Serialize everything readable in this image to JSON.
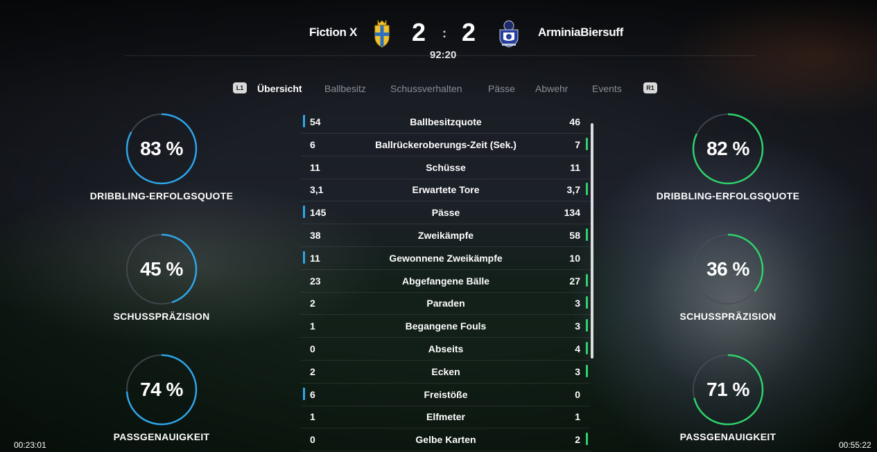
{
  "match": {
    "home_team": "Fiction X",
    "away_team": "ArminiaBiersuff",
    "home_score": "2",
    "away_score": "2",
    "separator": ":",
    "clock": "92:20"
  },
  "tabs": {
    "left_bumper": "L1",
    "right_bumper": "R1",
    "items": [
      {
        "label": "Übersicht",
        "active": true
      },
      {
        "label": "Ballbesitz",
        "active": false
      },
      {
        "label": "Schussverhalten",
        "active": false
      },
      {
        "label": "Pässe",
        "active": false
      },
      {
        "label": "Abwehr",
        "active": false
      },
      {
        "label": "Events",
        "active": false
      }
    ]
  },
  "home_rings": [
    {
      "value": "83 %",
      "fraction": 0.83,
      "label": "DRIBBLING-ERFOLGSQUOTE"
    },
    {
      "value": "45 %",
      "fraction": 0.45,
      "label": "SCHUSSPRÄZISION"
    },
    {
      "value": "74 %",
      "fraction": 0.74,
      "label": "PASSGENAUIGKEIT"
    }
  ],
  "away_rings": [
    {
      "value": "82 %",
      "fraction": 0.82,
      "label": "DRIBBLING-ERFOLGSQUOTE"
    },
    {
      "value": "36 %",
      "fraction": 0.36,
      "label": "SCHUSSPRÄZISION"
    },
    {
      "value": "71 %",
      "fraction": 0.71,
      "label": "PASSGENAUIGKEIT"
    }
  ],
  "stats": [
    {
      "label": "Ballbesitzquote",
      "home": "54",
      "away": "46",
      "leader": "home"
    },
    {
      "label": "Ballrückeroberungs-Zeit (Sek.)",
      "home": "6",
      "away": "7",
      "leader": "away"
    },
    {
      "label": "Schüsse",
      "home": "11",
      "away": "11",
      "leader": "none"
    },
    {
      "label": "Erwartete Tore",
      "home": "3,1",
      "away": "3,7",
      "leader": "away"
    },
    {
      "label": "Pässe",
      "home": "145",
      "away": "134",
      "leader": "home"
    },
    {
      "label": "Zweikämpfe",
      "home": "38",
      "away": "58",
      "leader": "away"
    },
    {
      "label": "Gewonnene Zweikämpfe",
      "home": "11",
      "away": "10",
      "leader": "home"
    },
    {
      "label": "Abgefangene Bälle",
      "home": "23",
      "away": "27",
      "leader": "away"
    },
    {
      "label": "Paraden",
      "home": "2",
      "away": "3",
      "leader": "away"
    },
    {
      "label": "Begangene Fouls",
      "home": "1",
      "away": "3",
      "leader": "away"
    },
    {
      "label": "Abseits",
      "home": "0",
      "away": "4",
      "leader": "away"
    },
    {
      "label": "Ecken",
      "home": "2",
      "away": "3",
      "leader": "away"
    },
    {
      "label": "Freistöße",
      "home": "6",
      "away": "0",
      "leader": "home"
    },
    {
      "label": "Elfmeter",
      "home": "1",
      "away": "1",
      "leader": "none"
    },
    {
      "label": "Gelbe Karten",
      "home": "0",
      "away": "2",
      "leader": "away"
    }
  ],
  "colors": {
    "home_accent": "#2ea6ea",
    "away_accent": "#2fd36b",
    "ring_track": "#4a4e55"
  },
  "timestamps": {
    "left": "00:23:01",
    "right": "00:55:22"
  }
}
